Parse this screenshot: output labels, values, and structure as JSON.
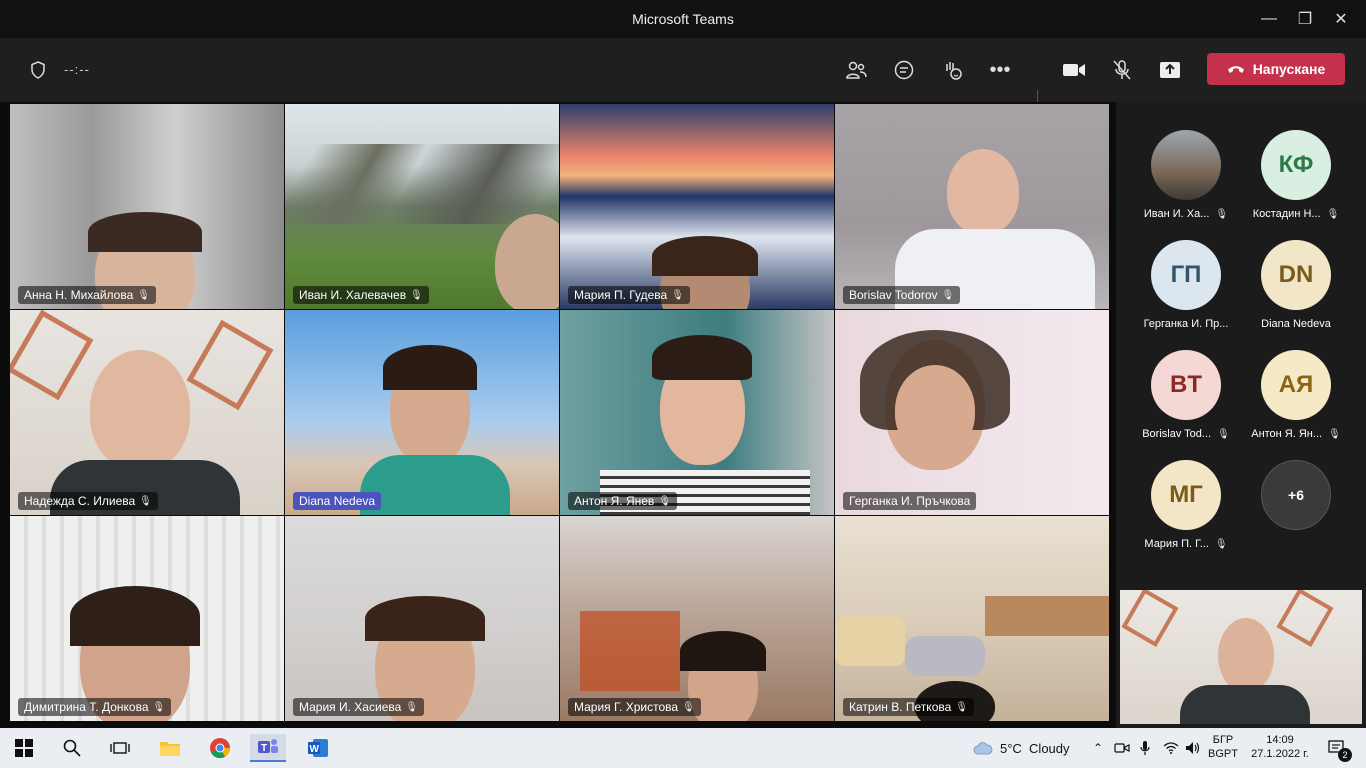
{
  "window": {
    "title": "Microsoft Teams"
  },
  "toolbar": {
    "timer": "--:--",
    "leave_label": "Напускане",
    "icons": [
      "shield-icon",
      "participants-icon",
      "chat-icon",
      "reactions-icon",
      "more-icon",
      "camera-icon",
      "mic-muted-icon",
      "share-icon",
      "phone-icon"
    ]
  },
  "tiles": [
    {
      "name": "Анна Н. Михайлова",
      "muted": true
    },
    {
      "name": "Иван И. Халевачев",
      "muted": true
    },
    {
      "name": "Мария П. Гудева",
      "muted": true
    },
    {
      "name": "Borislav Todorov",
      "muted": true
    },
    {
      "name": "Надежда С. Илиева",
      "muted": true
    },
    {
      "name": "Diana Nedeva",
      "muted": false
    },
    {
      "name": "Антон Я. Янев",
      "muted": true
    },
    {
      "name": "Герганка И. Пръчкова",
      "muted": false
    },
    {
      "name": "Димитрина Т. Донкова",
      "muted": true
    },
    {
      "name": "Мария И. Хасиева",
      "muted": true
    },
    {
      "name": "Мария Г. Христова",
      "muted": true
    },
    {
      "name": "Катрин В. Петкова",
      "muted": true
    }
  ],
  "rail": [
    {
      "initials": "",
      "name": "Иван И. Ха...",
      "muted": true,
      "color": "#6b5a4a",
      "fg": "#fff"
    },
    {
      "initials": "КФ",
      "name": "Костадин Н...",
      "muted": true,
      "color": "#d8efe1",
      "fg": "#2b7a4b"
    },
    {
      "initials": "ГП",
      "name": "Герганка И. Пр...",
      "muted": false,
      "color": "#dbe6ef",
      "fg": "#33566e"
    },
    {
      "initials": "DN",
      "name": "Diana Nedeva",
      "muted": false,
      "color": "#f2e6c9",
      "fg": "#7a5a1a"
    },
    {
      "initials": "BT",
      "name": "Borislav Tod...",
      "muted": true,
      "color": "#f4d8d6",
      "fg": "#8a2a22"
    },
    {
      "initials": "АЯ",
      "name": "Антон Я. Ян...",
      "muted": true,
      "color": "#f6e9c6",
      "fg": "#8a6515"
    },
    {
      "initials": "МГ",
      "name": "Мария П. Г...",
      "muted": true,
      "color": "#f3e6c6",
      "fg": "#7a5a18"
    },
    {
      "initials": "+6",
      "name": "",
      "muted": false,
      "color": "#3a3a3a",
      "fg": "#fff"
    }
  ],
  "taskbar": {
    "weather": "5°C  Cloudy",
    "lang_top": "БГР",
    "lang_bottom": "BGPT",
    "time": "14:09",
    "date": "27.1.2022 г.",
    "notifications": "2"
  }
}
